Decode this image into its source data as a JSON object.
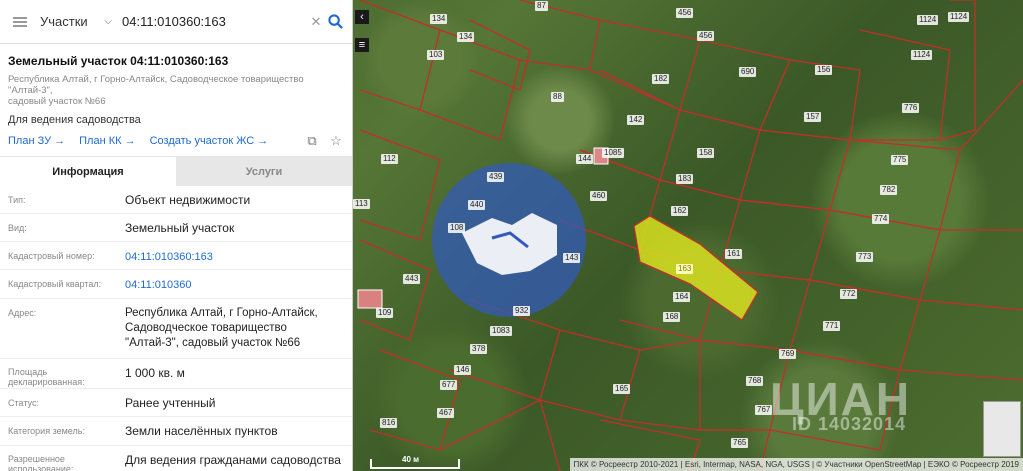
{
  "search": {
    "type_label": "Участки",
    "query": "04:11:010360:163"
  },
  "parcel": {
    "title": "Земельный участок 04:11:010360:163",
    "address_line1": "Республика Алтай, г Горно-Алтайск, Садоводческое товарищество \"Алтай-3\",",
    "address_line2": "садовый участок №66",
    "purpose": "Для ведения садоводства"
  },
  "links": {
    "plan_zu": "План ЗУ →",
    "plan_kk": "План КК →",
    "create_zhs": "Создать участок ЖС →"
  },
  "tabs": {
    "info": "Информация",
    "services": "Услуги"
  },
  "fields": [
    {
      "key": "Тип:",
      "value": "Объект недвижимости"
    },
    {
      "key": "Вид:",
      "value": "Земельный участок"
    },
    {
      "key": "Кадастровый номер:",
      "value": "04:11:010360:163"
    },
    {
      "key": "Кадастровый квартал:",
      "value": "04:11:010360"
    },
    {
      "key": "Адрес:",
      "value": "Республика Алтай, г Горно-Алтайск, Садоводческое товарищество \"Алтай-3\", садовый участок №66"
    },
    {
      "key": "Площадь декларированная:",
      "value": "1 000 кв. м"
    },
    {
      "key": "Статус:",
      "value": "Ранее учтенный"
    },
    {
      "key": "Категория земель:",
      "value": "Земли населённых пунктов"
    },
    {
      "key": "Разрешенное использование:",
      "value": "Для ведения гражданами садоводства и огородничества"
    }
  ],
  "map": {
    "parcel_numbers": [
      "87",
      "134",
      "134",
      "103",
      "456",
      "456",
      "1124",
      "1124",
      "1124",
      "182",
      "690",
      "156",
      "776",
      "88",
      "142",
      "157",
      "144",
      "1085",
      "158",
      "775",
      "112",
      "183",
      "782",
      "460",
      "113",
      "162",
      "774",
      "108",
      "440",
      "439",
      "143",
      "161",
      "773",
      "443",
      "163",
      "164",
      "772",
      "109",
      "932",
      "168",
      "771",
      "1083",
      "769",
      "378",
      "146",
      "768",
      "677",
      "165",
      "767",
      "467",
      "816",
      "765"
    ],
    "selected_parcel": "163",
    "scale_label": "40 м",
    "attribution": "ПКК © Росреестр 2010-2021 | Esri, Intermap, NASA, NGA, USGS | © Участники OpenStreetMap | ЕЭКО © Росреестр 2019",
    "watermark_brand": "ЦИАН",
    "watermark_id": "ID 14032014",
    "colors": {
      "parcel_border": "#c0302a",
      "selected_fill": "#d8e020",
      "watermark_circle": "#3258be"
    }
  }
}
